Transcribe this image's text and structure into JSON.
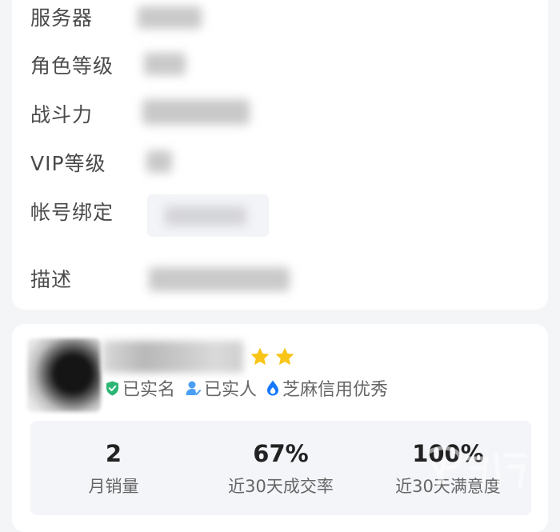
{
  "account_info": {
    "fields": [
      {
        "label": "服务器"
      },
      {
        "label": "角色等级"
      },
      {
        "label": "战斗力"
      },
      {
        "label": "VIP等级"
      },
      {
        "label": "帐号绑定"
      },
      {
        "label": "描述"
      }
    ]
  },
  "seller": {
    "star_count": 2,
    "badges": [
      {
        "label": "已实名",
        "icon": "verified-shield-icon"
      },
      {
        "label": "已实人",
        "icon": "person-verified-icon"
      },
      {
        "label": "芝麻信用优秀",
        "icon": "sesame-credit-icon"
      }
    ],
    "stats": [
      {
        "value": "2",
        "label": "月销量"
      },
      {
        "value": "67%",
        "label": "近30天成交率"
      },
      {
        "value": "100%",
        "label": "近30天满意度"
      }
    ]
  },
  "colors": {
    "star": "#f8c516",
    "badge_green": "#2bb673",
    "badge_blue": "#4a9ff5",
    "sesame_blue": "#1677ff"
  }
}
